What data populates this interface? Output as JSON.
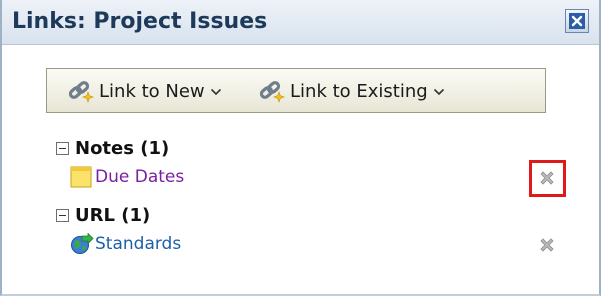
{
  "panel": {
    "title": "Links: Project Issues",
    "close_icon": "close-x-icon"
  },
  "toolbar": {
    "link_to_new": "Link to New",
    "link_to_existing": "Link to Existing",
    "link_icon": "chain-link-icon",
    "chevron_icon": "chevron-down-icon"
  },
  "groups": [
    {
      "label": "Notes (1)",
      "items": [
        {
          "name": "Due Dates",
          "icon": "note-icon",
          "delete_icon": "delete-x-icon"
        }
      ]
    },
    {
      "label": "URL (1)",
      "items": [
        {
          "name": "Standards",
          "icon": "globe-link-icon",
          "delete_icon": "delete-x-icon"
        }
      ]
    }
  ],
  "colors": {
    "note_link": "#7b1fa2",
    "url_link": "#1d5fa8",
    "highlight": "#e01919"
  }
}
